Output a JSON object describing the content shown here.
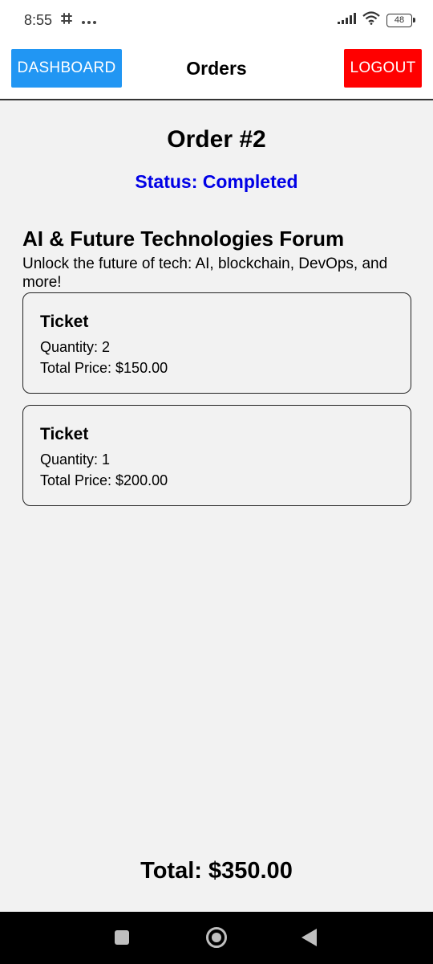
{
  "status_bar": {
    "time": "8:55",
    "notification_icons": [
      "slack-icon",
      "more-dots-icon"
    ],
    "battery": "48"
  },
  "header": {
    "dashboard_label": "DASHBOARD",
    "title": "Orders",
    "logout_label": "LOGOUT",
    "dashboard_color": "#2196f3",
    "logout_color": "#ff0000"
  },
  "order": {
    "title": "Order #2",
    "status": "Status: Completed",
    "status_color": "#0000e6",
    "event_name": "AI & Future Technologies Forum",
    "event_description": "Unlock the future of tech: AI, blockchain, DevOps, and more!",
    "tickets": [
      {
        "name": "Ticket",
        "quantity": "Quantity: 2",
        "total_price": "Total Price: $150.00"
      },
      {
        "name": "Ticket",
        "quantity": "Quantity: 1",
        "total_price": "Total Price: $200.00"
      }
    ],
    "grand_total": "Total: $350.00"
  },
  "nav_bar": {
    "buttons": [
      "recents-square-icon",
      "home-circle-icon",
      "back-triangle-icon"
    ]
  }
}
